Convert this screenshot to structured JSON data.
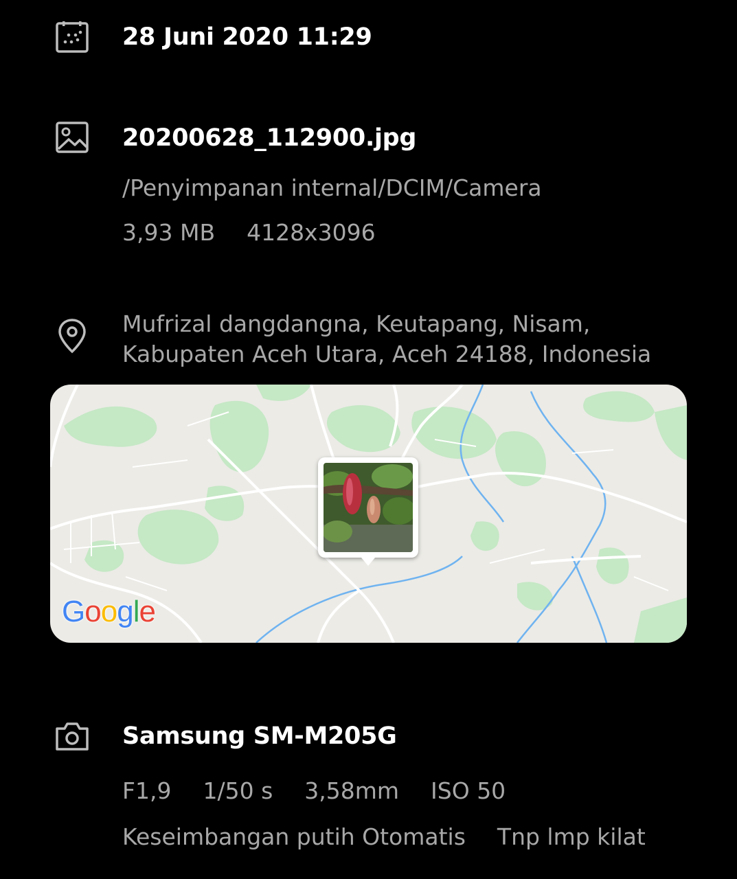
{
  "datetime": {
    "icon": "calendar-icon",
    "text": "28 Juni 2020 11:29"
  },
  "file": {
    "icon": "image-icon",
    "name": "20200628_112900.jpg",
    "path": "/Penyimpanan internal/DCIM/Camera",
    "size": "3,93 MB",
    "resolution": "4128x3096"
  },
  "location": {
    "icon": "location-pin-icon",
    "address_line1": "Mufrizal dangdangna, Keutapang, Nisam,",
    "address_line2": "Kabupaten Aceh Utara, Aceh 24188, Indonesia",
    "map_logo": {
      "g1": "G",
      "o1": "o",
      "o2": "o",
      "g2": "g",
      "l": "l",
      "e": "e"
    }
  },
  "camera": {
    "icon": "camera-icon",
    "model": "Samsung SM-M205G",
    "aperture": "F1,9",
    "shutter": "1/50 s",
    "focal_length": "3,58mm",
    "iso": "ISO 50",
    "white_balance": "Keseimbangan putih Otomatis",
    "flash": "Tnp lmp kilat"
  },
  "colors": {
    "background": "#000000",
    "primary_text": "#ffffff",
    "secondary_text": "#a8a8a8",
    "map_land": "#ecebe6",
    "map_green": "#c5e8c5",
    "map_water": "#6fb3f0"
  }
}
